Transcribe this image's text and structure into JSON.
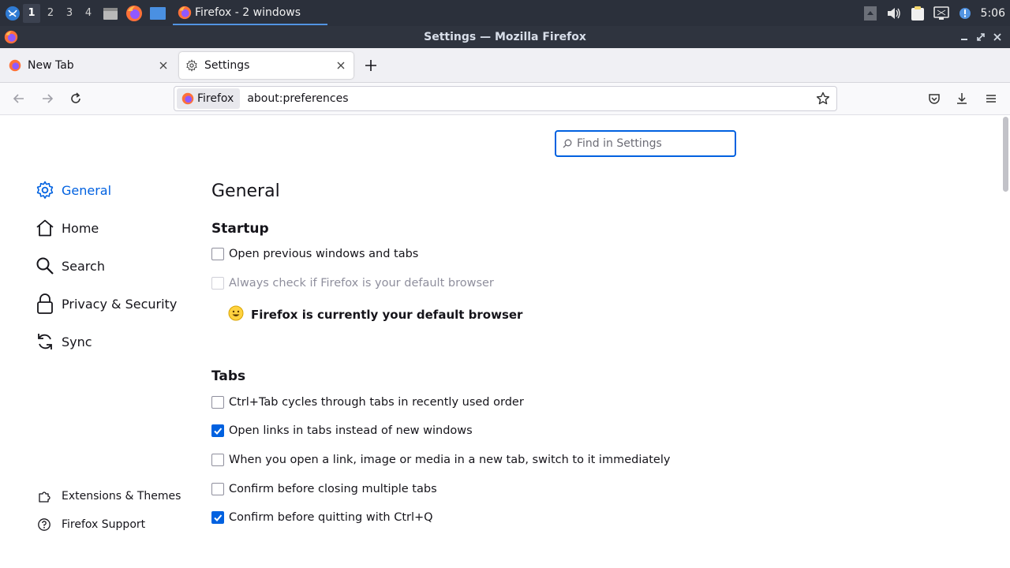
{
  "taskbar": {
    "workspaces": [
      "1",
      "2",
      "3",
      "4"
    ],
    "window_label": "Firefox - 2 windows",
    "clock": "5:06"
  },
  "titlebar": {
    "title": "Settings — Mozilla Firefox"
  },
  "tabs": [
    {
      "label": "New Tab"
    },
    {
      "label": "Settings"
    }
  ],
  "navbar": {
    "identity_label": "Firefox",
    "url": "about:preferences"
  },
  "search": {
    "placeholder": "Find in Settings"
  },
  "sidebar": {
    "items": [
      {
        "label": "General",
        "icon": "gear-icon"
      },
      {
        "label": "Home",
        "icon": "home-icon"
      },
      {
        "label": "Search",
        "icon": "search-icon"
      },
      {
        "label": "Privacy & Security",
        "icon": "lock-icon"
      },
      {
        "label": "Sync",
        "icon": "sync-icon"
      }
    ],
    "footer": [
      {
        "label": "Extensions & Themes",
        "icon": "puzzle-icon"
      },
      {
        "label": "Firefox Support",
        "icon": "help-icon"
      }
    ]
  },
  "main": {
    "title": "General",
    "startup": {
      "heading": "Startup",
      "open_previous": "Open previous windows and tabs",
      "always_check": "Always check if Firefox is your default browser",
      "default_msg": "Firefox is currently your default browser"
    },
    "tabs_section": {
      "heading": "Tabs",
      "options": [
        {
          "label": "Ctrl+Tab cycles through tabs in recently used order",
          "checked": false
        },
        {
          "label": "Open links in tabs instead of new windows",
          "checked": true
        },
        {
          "label": "When you open a link, image or media in a new tab, switch to it immediately",
          "checked": false
        },
        {
          "label": "Confirm before closing multiple tabs",
          "checked": false
        },
        {
          "label": "Confirm before quitting with Ctrl+Q",
          "checked": true
        }
      ]
    }
  },
  "colors": {
    "accent": "#0061e0",
    "taskbar": "#2b303b",
    "titlebar": "#2f343f"
  }
}
